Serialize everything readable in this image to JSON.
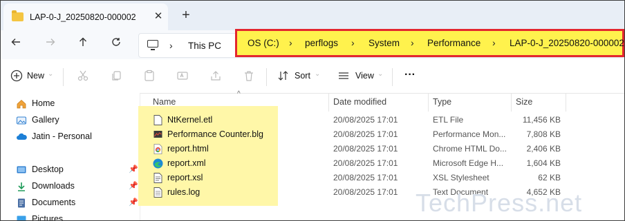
{
  "tab": {
    "title": "LAP-0-J_20250820-000002",
    "close": "✕",
    "new": "+"
  },
  "address": {
    "root": "This PC",
    "crumbs": [
      "OS (C:)",
      "perflogs",
      "System",
      "Performance",
      "LAP-0-J_20250820-000002"
    ]
  },
  "commandbar": {
    "new": "New",
    "sort": "Sort",
    "view": "View",
    "more": "···"
  },
  "sidebar": {
    "items": [
      {
        "label": "Home",
        "icon": "home-icon"
      },
      {
        "label": "Gallery",
        "icon": "gallery-icon"
      },
      {
        "label": "Jatin - Personal",
        "icon": "onedrive-cloud-icon"
      },
      {
        "label": "Desktop",
        "icon": "desktop-icon"
      },
      {
        "label": "Downloads",
        "icon": "download-icon"
      },
      {
        "label": "Documents",
        "icon": "documents-icon"
      },
      {
        "label": "Pictures",
        "icon": "pictures-icon"
      }
    ]
  },
  "columns": {
    "name": "Name",
    "date": "Date modified",
    "type": "Type",
    "size": "Size"
  },
  "files": [
    {
      "name": "NtKernel.etl",
      "date": "20/08/2025 17:01",
      "type": "ETL File",
      "size": "11,456 KB",
      "icon": "generic-file-icon"
    },
    {
      "name": "Performance Counter.blg",
      "date": "20/08/2025 17:01",
      "type": "Performance Mon...",
      "size": "7,808 KB",
      "icon": "perfmon-file-icon"
    },
    {
      "name": "report.html",
      "date": "20/08/2025 17:01",
      "type": "Chrome HTML Do...",
      "size": "2,406 KB",
      "icon": "chrome-icon"
    },
    {
      "name": "report.xml",
      "date": "20/08/2025 17:01",
      "type": "Microsoft Edge H...",
      "size": "1,604 KB",
      "icon": "edge-icon"
    },
    {
      "name": "report.xsl",
      "date": "20/08/2025 17:01",
      "type": "XSL Stylesheet",
      "size": "62 KB",
      "icon": "xsl-file-icon"
    },
    {
      "name": "rules.log",
      "date": "20/08/2025 17:01",
      "type": "Text Document",
      "size": "4,652 KB",
      "icon": "text-file-icon"
    }
  ],
  "watermark": "TechPress.net",
  "colors": {
    "highlight_yellow": "#fff24d",
    "highlight_border": "#e3262e",
    "file_highlight": "#fff7a8",
    "accent": "#0067c0"
  }
}
